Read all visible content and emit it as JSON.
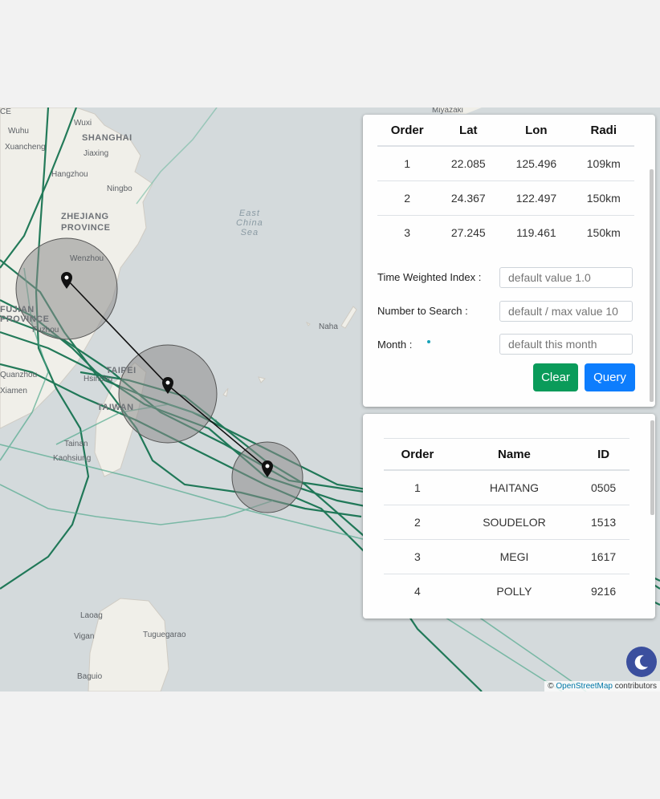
{
  "map": {
    "labels": {
      "shanghai": "SHANGHAI",
      "zhejiang": "ZHEJIANG",
      "province": "PROVINCE",
      "fujian": "FUJIAN",
      "fujian_province": "PROVINCE",
      "east_china_sea_1": "East",
      "east_china_sea_2": "China",
      "east_china_sea_3": "Sea",
      "wuxi": "Wuxi",
      "wuhu": "Wuhu",
      "jiaxing": "Jiaxing",
      "hangzhou": "Hangzhou",
      "ningbo": "Ningbo",
      "wenzhou": "Wenzhou",
      "fuzhou": "Fuzhou",
      "quanzhou": "Quanzhou",
      "xiamen": "Xiamen",
      "taipei": "TAIPEI",
      "hsinchu": "Hsinchu",
      "taiwan": "TAIWAN",
      "tainan": "Tainan",
      "kaohsiung": "Kaohsiung",
      "naha": "Naha",
      "miyazaki": "Miyazaki",
      "laoag": "Laoag",
      "vigan": "Vigan",
      "tuguegarao": "Tuguegarao",
      "baguio": "Baguio",
      "xuancheng": "Xuancheng",
      "ce": "CE"
    },
    "attribution_prefix": "©",
    "attribution_link": "OpenStreetMap",
    "attribution_suffix": "contributors"
  },
  "points_panel": {
    "headers": [
      "Order",
      "Lat",
      "Lon",
      "Radi"
    ],
    "rows": [
      {
        "order": "1",
        "lat": "22.085",
        "lon": "125.496",
        "radi": "109km"
      },
      {
        "order": "2",
        "lat": "24.367",
        "lon": "122.497",
        "radi": "150km"
      },
      {
        "order": "3",
        "lat": "27.245",
        "lon": "119.461",
        "radi": "150km"
      }
    ],
    "form": {
      "time_weighted_label": "Time Weighted Index :",
      "time_weighted_placeholder": "default value 1.0",
      "number_label": "Number to Search :",
      "number_placeholder": "default / max value 10",
      "month_label": "Month :",
      "month_placeholder": "default this month"
    },
    "buttons": {
      "clear": "Clear",
      "query": "Query"
    },
    "colors": {
      "clear": "#0a9b5a",
      "query": "#0d7dfd"
    }
  },
  "results_panel": {
    "headers": [
      "Order",
      "Name",
      "ID"
    ],
    "rows": [
      {
        "order": "1",
        "name": "HAITANG",
        "id": "0505"
      },
      {
        "order": "2",
        "name": "SOUDELOR",
        "id": "1513"
      },
      {
        "order": "3",
        "name": "MEGI",
        "id": "1617"
      },
      {
        "order": "4",
        "name": "POLLY",
        "id": "9216"
      }
    ]
  },
  "theme_toggle": {
    "icon": "moon-icon"
  }
}
